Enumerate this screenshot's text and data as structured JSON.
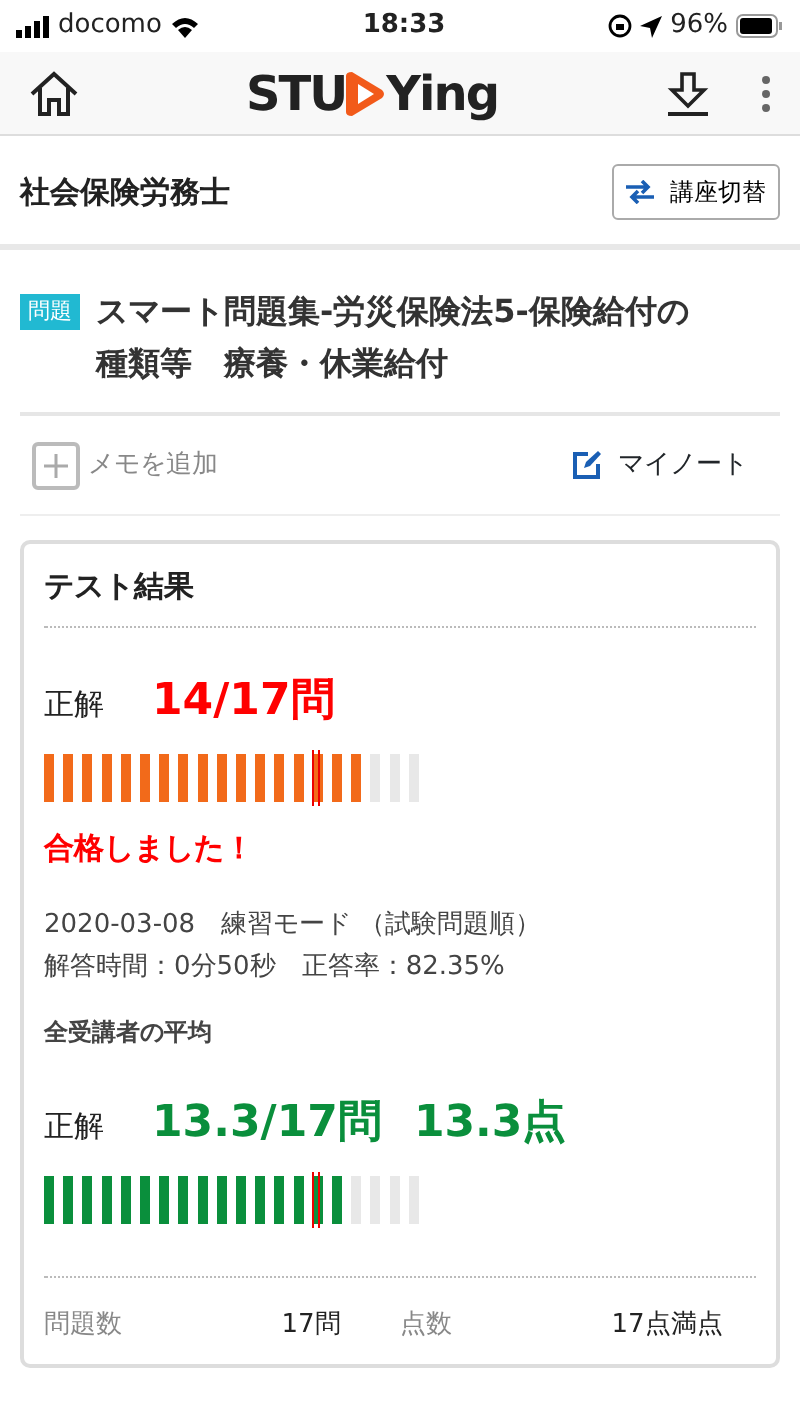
{
  "status_bar": {
    "carrier": "docomo",
    "time": "18:33",
    "battery": "96%"
  },
  "app_bar": {
    "logo_left": "STU",
    "logo_right": "Ying"
  },
  "course": {
    "title": "社会保険労務士",
    "switch_button": "講座切替"
  },
  "question": {
    "tag": "問題",
    "title": "スマート問題集-労災保険法5-保険給付の種類等　療養・休業給付"
  },
  "actions": {
    "memo": "メモを追加",
    "note": "マイノート"
  },
  "result": {
    "heading": "テスト結果",
    "score": {
      "label": "正解",
      "value": "14/17問",
      "level": 0.85
    },
    "passed": "合格しました！",
    "meta": [
      "2020-03-08　練習モード （試験問題順）",
      "解答時間：0分50秒　正答率：82.35%"
    ],
    "average_heading": "全受講者の平均",
    "average": {
      "label": "正解",
      "value": "13.3/17問",
      "points": "13.3点",
      "level": 0.8
    },
    "summary": [
      {
        "label": "問題数",
        "value": "17問"
      },
      {
        "label": "点数",
        "value": "17点満点"
      }
    ]
  }
}
